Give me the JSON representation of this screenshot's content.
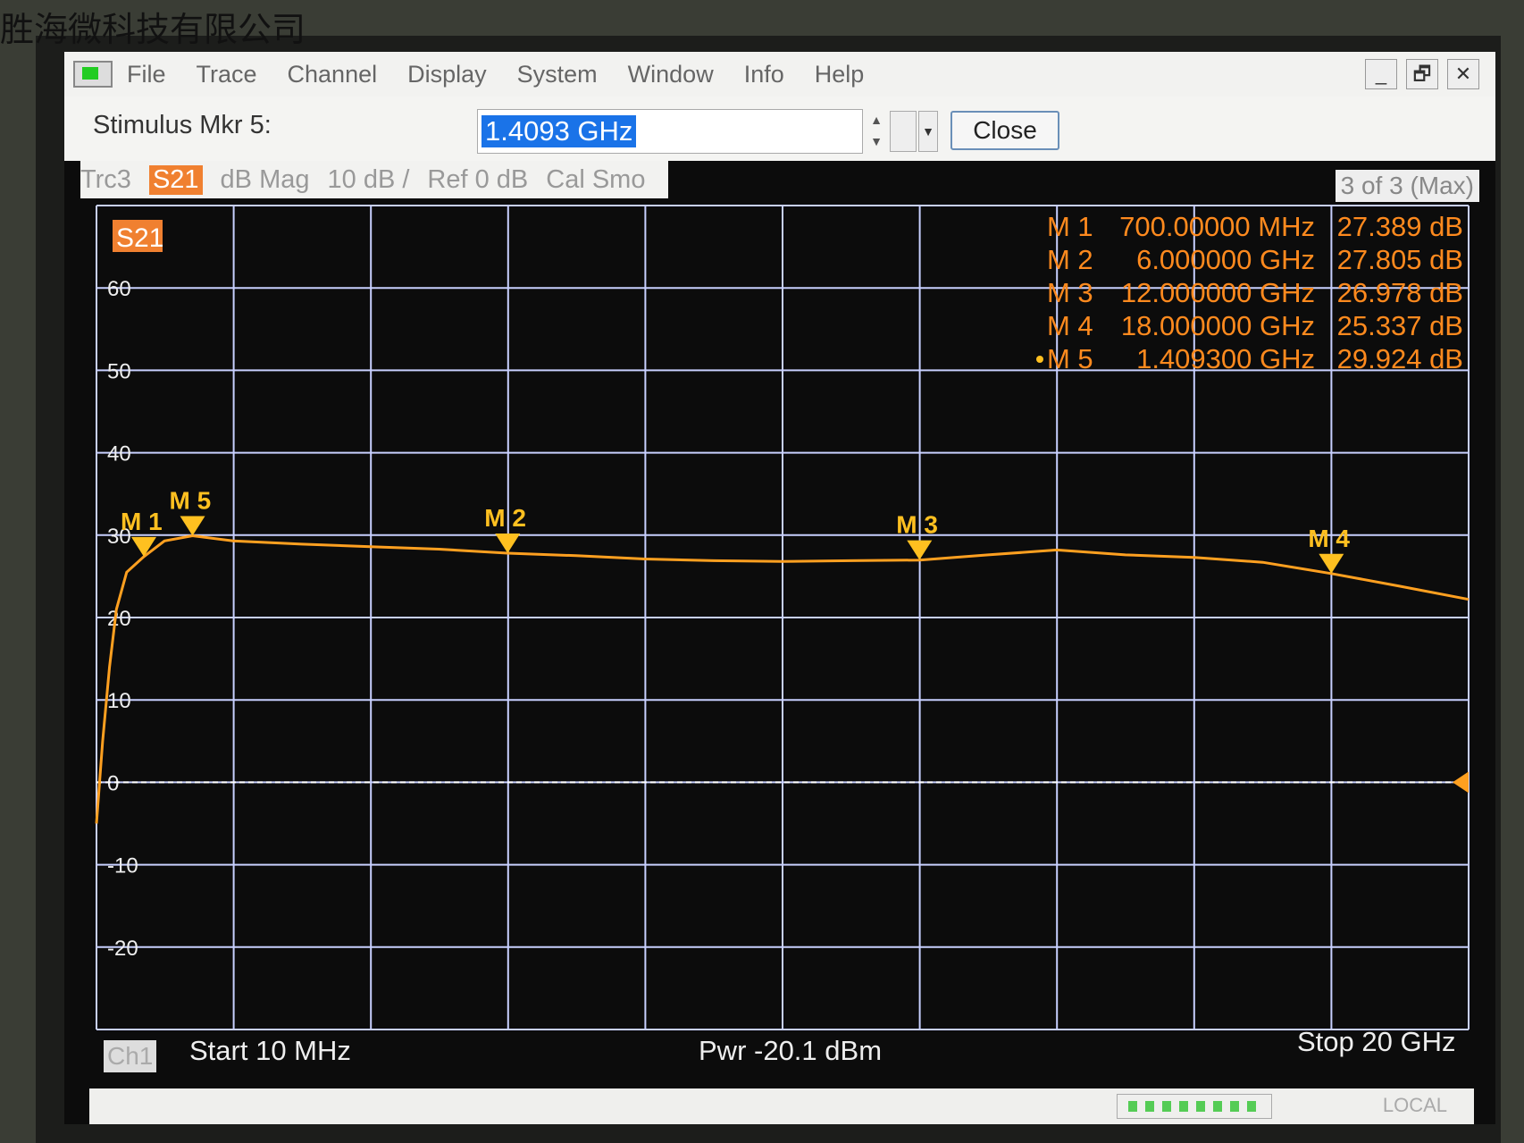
{
  "watermark": "胜海微科技有限公司",
  "menu": [
    "File",
    "Trace",
    "Channel",
    "Display",
    "System",
    "Window",
    "Info",
    "Help"
  ],
  "window_buttons": [
    "_",
    "🗗",
    "✕"
  ],
  "toolbar": {
    "stimulus_label": "Stimulus Mkr 5:",
    "stimulus_value": "1.4093 GHz",
    "close_label": "Close"
  },
  "tracebar": {
    "trace": "Trc3",
    "param": "S21",
    "format": "dB Mag",
    "scale": "10 dB /",
    "ref": "Ref 0 dB",
    "cal": "Cal Smo",
    "count": "3 of 3 (Max)"
  },
  "footer": {
    "channel": "Ch1",
    "start": "Start  10 MHz",
    "power": "Pwr  -20.1 dBm",
    "stop": "Stop  20 GHz",
    "local": "LOCAL"
  },
  "colors": {
    "trace": "#ffa020",
    "marker_text": "#ff8a1e",
    "grid": "#c8d0ff",
    "background": "#0c0c0c"
  },
  "chart_data": {
    "type": "line",
    "trace_label": "S21",
    "xlim_hz": [
      10000000,
      20000000000
    ],
    "ylim": [
      -30,
      70
    ],
    "grid": true,
    "y_ticks": [
      60,
      50,
      40,
      30,
      20,
      10,
      0,
      -10,
      -20
    ],
    "ref_level": 0,
    "series": [
      {
        "x_ghz": [
          0.01,
          0.1,
          0.2,
          0.3,
          0.45,
          0.7,
          1.0,
          1.409,
          2,
          3,
          4,
          5,
          6,
          7,
          8,
          9,
          10,
          11,
          12,
          13,
          14,
          15,
          16,
          17,
          18,
          19,
          20
        ],
        "y_db": [
          -5,
          5,
          14,
          21,
          25.5,
          27.389,
          29.3,
          29.924,
          29.3,
          28.9,
          28.6,
          28.3,
          27.805,
          27.5,
          27.1,
          26.9,
          26.8,
          26.9,
          26.978,
          27.6,
          28.2,
          27.6,
          27.3,
          26.7,
          25.337,
          23.8,
          22.2
        ]
      }
    ],
    "markers": [
      {
        "label": "M 1",
        "stimulus": "700.00000 MHz",
        "x_ghz": 0.7,
        "value": "27.389 dB",
        "y_db": 27.389
      },
      {
        "label": "M 2",
        "stimulus": "6.000000 GHz",
        "x_ghz": 6.0,
        "value": "27.805 dB",
        "y_db": 27.805
      },
      {
        "label": "M 3",
        "stimulus": "12.000000 GHz",
        "x_ghz": 12.0,
        "value": "26.978 dB",
        "y_db": 26.978
      },
      {
        "label": "M 4",
        "stimulus": "18.000000 GHz",
        "x_ghz": 18.0,
        "value": "25.337 dB",
        "y_db": 25.337
      },
      {
        "label": "M 5",
        "stimulus": "1.409300 GHz",
        "x_ghz": 1.4093,
        "value": "29.924 dB",
        "y_db": 29.924,
        "active": true
      }
    ]
  }
}
